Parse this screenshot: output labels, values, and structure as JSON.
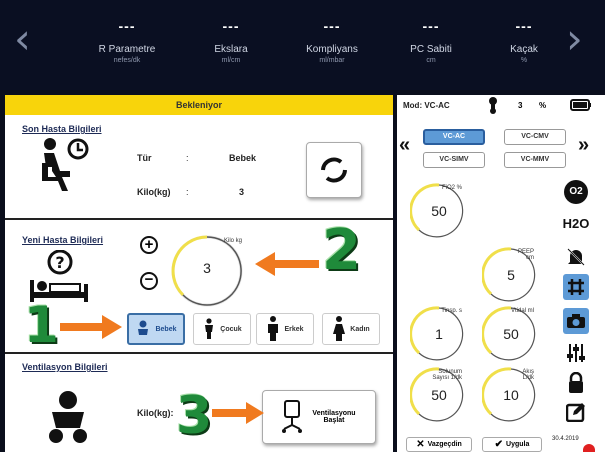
{
  "top_bar": {
    "params": [
      {
        "value": "---",
        "label": "R Parametre",
        "sub": "nefes/dk"
      },
      {
        "value": "---",
        "label": "Ekslara",
        "sub": "ml/cm"
      },
      {
        "value": "---",
        "label": "Kompliyans",
        "sub": "ml/mbar"
      },
      {
        "value": "---",
        "label": "PC Sabiti",
        "sub": "cm"
      },
      {
        "value": "---",
        "label": "Kaçak",
        "sub": "%"
      }
    ]
  },
  "left": {
    "status": "Bekleniyor",
    "last_patient": {
      "title": "Son Hasta Bilgileri",
      "type_label": "Tür",
      "type_sep": ":",
      "type_value": "Bebek",
      "weight_label": "Kilo(kg)",
      "weight_sep": ":",
      "weight_value": "3"
    },
    "new_patient": {
      "title": "Yeni Hasta Bilgileri",
      "dial_label": "Kilo kg",
      "dial_value": "3",
      "types": [
        "Bebek",
        "Çocuk",
        "Erkek",
        "Kadın"
      ],
      "selected_type": "Bebek"
    },
    "ventilation": {
      "title": "Ventilasyon Bilgileri",
      "weight_label": "Kilo(kg):",
      "start_label": "Ventilasyonu Başlat"
    },
    "annotations": [
      "1",
      "2",
      "3"
    ]
  },
  "right": {
    "mode_label": "Mod: VC-AC",
    "temp_value": "3",
    "temp_unit": "%",
    "modes": [
      "VC-AC",
      "VC-CMV",
      "VC-SIMV",
      "VC-MMV"
    ],
    "selected_mode": "VC-AC",
    "dials": [
      {
        "label": "FiO2 %",
        "value": "50"
      },
      {
        "label": "PEEP cm",
        "value": "5"
      },
      {
        "label": "Tinsp. s",
        "value": "1"
      },
      {
        "label": "Vtidal ml",
        "value": "50"
      },
      {
        "label": "Solunum Sayısı 1/dk",
        "value": "50"
      },
      {
        "label": "Akış L/dk",
        "value": "10"
      }
    ],
    "side_icons": [
      "O2",
      "H2O"
    ],
    "cancel_label": "Vazgeçdin",
    "apply_label": "Uygula",
    "date": "30.4.2019"
  },
  "colors": {
    "accent_yellow": "#f8d40b",
    "blue_select": "#5d9ad6",
    "dark_bar": "#0a0f22",
    "arrow": "#f07a1f",
    "annotation": "#1f8a3a"
  }
}
